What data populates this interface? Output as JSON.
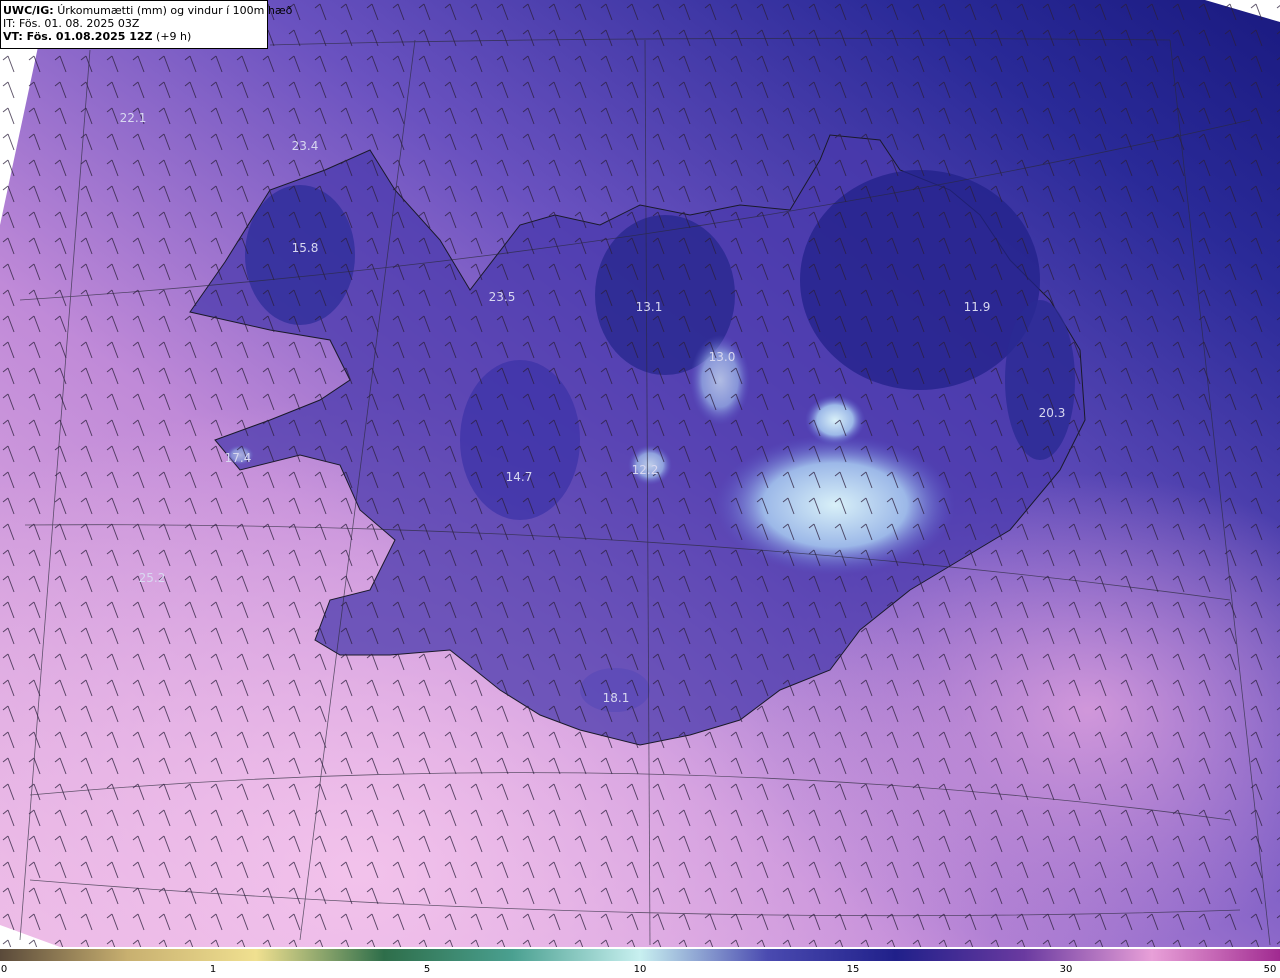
{
  "header": {
    "model": "UWC/IG:",
    "title": "Úrkomumætti (mm) og vindur í 100m hæð",
    "init_time": "IT: Fös. 01. 08. 2025 03Z",
    "valid_prefix": "VT: Fös. 01.08.2025 12Z",
    "valid_suffix": "(+9 h)"
  },
  "map_labels": [
    {
      "id": "label-22-1",
      "text": "22.1"
    },
    {
      "id": "label-23-4",
      "text": "23.4"
    },
    {
      "id": "label-15-8",
      "text": "15.8"
    },
    {
      "id": "label-23-5",
      "text": "23.5"
    },
    {
      "id": "label-13-1",
      "text": "13.1"
    },
    {
      "id": "label-13-0",
      "text": "13.0"
    },
    {
      "id": "label-11-9",
      "text": "11.9"
    },
    {
      "id": "label-20-3",
      "text": "20.3"
    },
    {
      "id": "label-17-4",
      "text": "17.4"
    },
    {
      "id": "label-14-7",
      "text": "14.7"
    },
    {
      "id": "label-12-2",
      "text": "12.2"
    },
    {
      "id": "label-25-2",
      "text": "25.2"
    },
    {
      "id": "label-18-1",
      "text": "18.1"
    }
  ],
  "colorbar": {
    "ticks": [
      "0",
      "1",
      "5",
      "10",
      "15",
      "30",
      "50"
    ],
    "colors": [
      "#5a4a3a",
      "#c8b070",
      "#f0e090",
      "#2e6e4a",
      "#4aa090",
      "#c8f0f0",
      "#4a4ab0",
      "#20208a",
      "#6a3aa0",
      "#e8a0d8",
      "#a02a90"
    ]
  },
  "colors": {
    "field_low": "#e8b0e0",
    "field_mid": "#7a5ac8",
    "field_high": "#1e1e8a",
    "peak": "#c8e8f0"
  }
}
